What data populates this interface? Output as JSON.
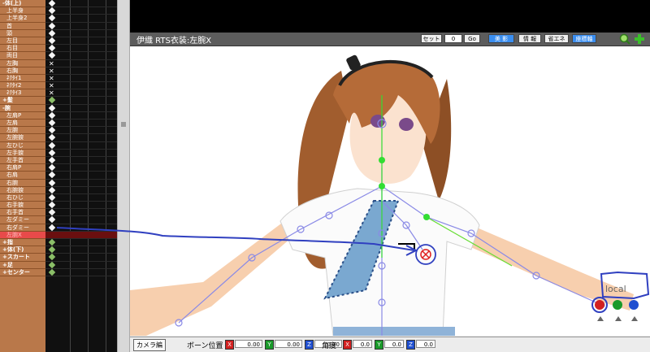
{
  "bone_list": [
    {
      "label": "-体(上)",
      "indent": false,
      "group": true,
      "key": "white"
    },
    {
      "label": "上半身",
      "indent": true,
      "key": "white"
    },
    {
      "label": "上半身2",
      "indent": true,
      "key": "white"
    },
    {
      "label": "首",
      "indent": true,
      "key": "white"
    },
    {
      "label": "頭",
      "indent": true,
      "key": "white"
    },
    {
      "label": "左目",
      "indent": true,
      "key": "white"
    },
    {
      "label": "右目",
      "indent": true,
      "key": "white"
    },
    {
      "label": "両目",
      "indent": true,
      "key": "white"
    },
    {
      "label": "左胸",
      "indent": true,
      "key": "x"
    },
    {
      "label": "右胸",
      "indent": true,
      "key": "x"
    },
    {
      "label": "ﾈｸﾀｲ1",
      "indent": true,
      "key": "x"
    },
    {
      "label": "ﾈｸﾀｲ2",
      "indent": true,
      "key": "x"
    },
    {
      "label": "ﾈｸﾀｲ3",
      "indent": true,
      "key": "x"
    },
    {
      "label": "+髪",
      "indent": false,
      "group": true,
      "key": "green"
    },
    {
      "label": "-腕",
      "indent": false,
      "group": true,
      "key": "white"
    },
    {
      "label": "左肩P",
      "indent": true,
      "key": "white"
    },
    {
      "label": "左肩",
      "indent": true,
      "key": "white"
    },
    {
      "label": "左腕",
      "indent": true,
      "key": "white"
    },
    {
      "label": "左腕捩",
      "indent": true,
      "key": "white"
    },
    {
      "label": "左ひじ",
      "indent": true,
      "key": "white"
    },
    {
      "label": "左手捩",
      "indent": true,
      "key": "white"
    },
    {
      "label": "左手首",
      "indent": true,
      "key": "white"
    },
    {
      "label": "右肩P",
      "indent": true,
      "key": "white"
    },
    {
      "label": "右肩",
      "indent": true,
      "key": "white"
    },
    {
      "label": "右腕",
      "indent": true,
      "key": "white"
    },
    {
      "label": "右腕捩",
      "indent": true,
      "key": "white"
    },
    {
      "label": "右ひじ",
      "indent": true,
      "key": "white"
    },
    {
      "label": "右手捩",
      "indent": true,
      "key": "white"
    },
    {
      "label": "右手首",
      "indent": true,
      "key": "white"
    },
    {
      "label": "左ダミー",
      "indent": true,
      "key": "white"
    },
    {
      "label": "右ダミー",
      "indent": true,
      "key": "white"
    },
    {
      "label": "左腕X",
      "indent": true,
      "selected": true,
      "key": "none"
    },
    {
      "label": "+指",
      "indent": false,
      "group": true,
      "key": "green"
    },
    {
      "label": "+体(下)",
      "indent": false,
      "group": true,
      "key": "green"
    },
    {
      "label": "+スカート",
      "indent": false,
      "group": true,
      "key": "green"
    },
    {
      "label": "+足",
      "indent": false,
      "group": true,
      "key": "green"
    },
    {
      "label": "+センター",
      "indent": false,
      "group": true,
      "key": "green"
    }
  ],
  "header": {
    "title": "伊織 RTS衣装:左腕X",
    "set_label": "セット",
    "frame_value": "0",
    "go_label": "Go",
    "beauty_label": "美 影",
    "info_label": "情 報",
    "energy_label": "省エネ",
    "axis_label": "座標軸"
  },
  "viewport": {
    "local_label": "local"
  },
  "bottom_bar": {
    "camera_label": "カメラ編",
    "bone_pos_label": "ボーン位置",
    "angle_label": "角度",
    "axes": [
      "X",
      "Y",
      "Z"
    ],
    "pos_values": [
      "0.00",
      "0.00",
      "0.00"
    ],
    "angle_values": [
      "0.0",
      "0.0",
      "0.0"
    ]
  },
  "colors": {
    "bone_list_bg": "#b9784a",
    "selected_row": "#e84a4a",
    "accent_blue": "#3a8ef0",
    "x_axis": "#d22020",
    "y_axis": "#1a9a2a",
    "z_axis": "#1f4fd0",
    "annotation_blue": "#3040c0"
  }
}
